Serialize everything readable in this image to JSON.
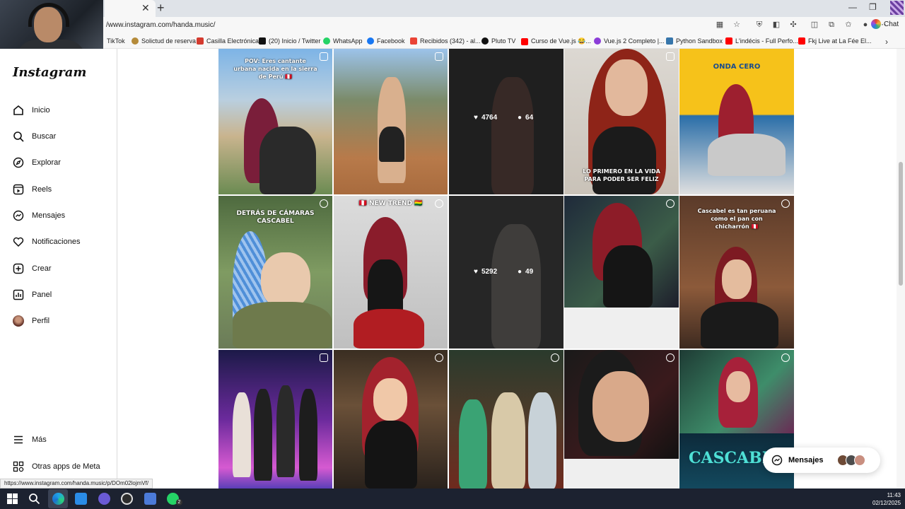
{
  "browser": {
    "url": "/www.instagram.com/handa.music/",
    "chat_label": "Chat",
    "bookmarks": [
      {
        "label": "TikTok"
      },
      {
        "label": "Solictud de reserva"
      },
      {
        "label": "Casilla Electrónica"
      },
      {
        "label": "(20) Inicio / Twitter"
      },
      {
        "label": "WhatsApp"
      },
      {
        "label": "Facebook"
      },
      {
        "label": "Recibidos (342) - al..."
      },
      {
        "label": "Pluto TV"
      },
      {
        "label": "Curso de Vue.js 😂..."
      },
      {
        "label": "Vue.js 2 Completo |..."
      },
      {
        "label": "Python Sandbox"
      },
      {
        "label": "L'indécis - Full Perfo..."
      },
      {
        "label": "Fkj Live at La Fée El..."
      }
    ]
  },
  "instagram": {
    "logo": "Instagram",
    "nav": [
      {
        "label": "Inicio",
        "icon": "home-icon"
      },
      {
        "label": "Buscar",
        "icon": "search-icon"
      },
      {
        "label": "Explorar",
        "icon": "compass-icon"
      },
      {
        "label": "Reels",
        "icon": "reels-icon"
      },
      {
        "label": "Mensajes",
        "icon": "messenger-icon"
      },
      {
        "label": "Notificaciones",
        "icon": "heart-icon"
      },
      {
        "label": "Crear",
        "icon": "plus-square-icon"
      },
      {
        "label": "Panel",
        "icon": "dashboard-icon"
      },
      {
        "label": "Perfil",
        "icon": "profile-avatar-icon"
      }
    ],
    "nav_bottom": [
      {
        "label": "Más",
        "icon": "menu-icon"
      },
      {
        "label": "Otras apps de Meta",
        "icon": "meta-apps-icon"
      }
    ],
    "posts": [
      {
        "caption": "POV: Eres cantante urbana nacida en la sierra de Perú 🇵🇪"
      },
      {
        "caption": ""
      },
      {
        "likes": "4764",
        "comments": "64"
      },
      {
        "caption": "LO PRIMERO EN LA VIDA PARA PODER SER FELIZ"
      },
      {
        "caption": "ONDA CERO"
      },
      {
        "caption": "DETRÁS DE CÁMARAS CASCABEL"
      },
      {
        "caption": "🇵🇪 NEW TREND 🇧🇴"
      },
      {
        "likes": "5292",
        "comments": "49"
      },
      {
        "caption": ""
      },
      {
        "caption": "Cascabel es tan peruana como el pan con chicharrón 🇵🇪"
      },
      {
        "caption": ""
      },
      {
        "caption": ""
      },
      {
        "caption": ""
      },
      {
        "caption": ""
      },
      {
        "caption": "CASCABEL"
      }
    ],
    "messages_label": "Mensajes"
  },
  "status_url": "https://www.instagram.com/handa.music/p/DOm02lojmVf/",
  "taskbar": {
    "time": "11:43",
    "date": "02/12/2025",
    "whatsapp_badge": "2"
  }
}
